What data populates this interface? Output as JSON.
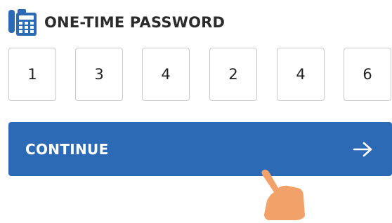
{
  "header": {
    "title": "ONE-TIME PASSWORD",
    "icon": "phone-keypad-icon"
  },
  "otp": {
    "digits": [
      "1",
      "3",
      "4",
      "2",
      "4",
      "6"
    ]
  },
  "continue_button": {
    "label": "CONTINUE",
    "icon": "arrow-right-icon"
  },
  "colors": {
    "primary": "#2c6ab5",
    "title_text": "#2b2b2b",
    "box_border": "#c9c9c9",
    "pointer": "#f2a168"
  }
}
